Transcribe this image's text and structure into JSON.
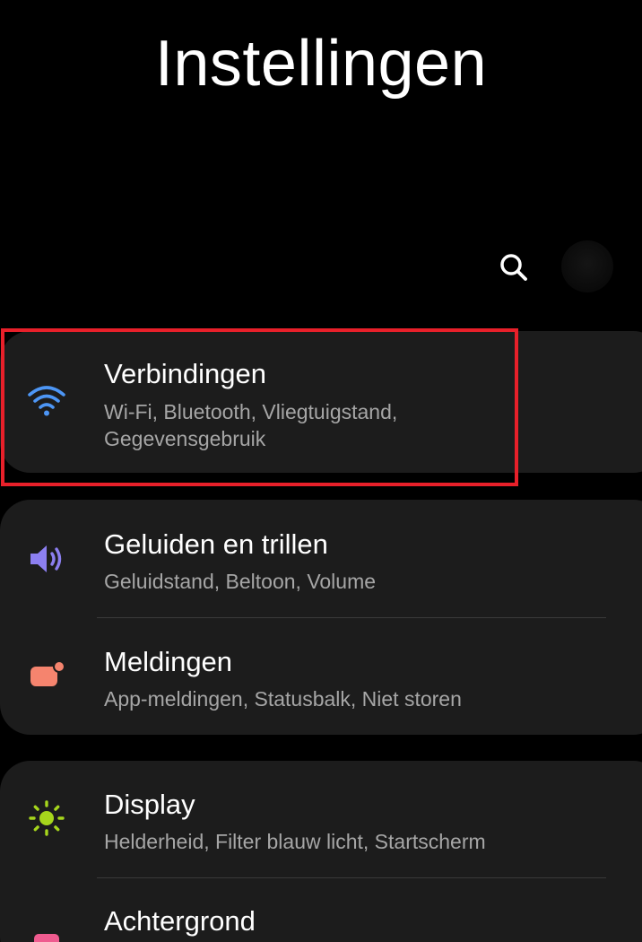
{
  "header": {
    "title": "Instellingen",
    "search_icon": "search-icon",
    "avatar_icon": "profile-avatar"
  },
  "groups": [
    {
      "items": [
        {
          "icon": "wifi-icon",
          "icon_color": "#4d96f5",
          "label": "Verbindingen",
          "subtitle": "Wi-Fi, Bluetooth, Vliegtuigstand, Gegevensgebruik",
          "highlighted": true
        }
      ]
    },
    {
      "items": [
        {
          "icon": "volume-icon",
          "icon_color": "#8c7ff0",
          "label": "Geluiden en trillen",
          "subtitle": "Geluidstand, Beltoon, Volume"
        },
        {
          "icon": "notification-icon",
          "icon_color": "#f5846e",
          "label": "Meldingen",
          "subtitle": "App-meldingen, Statusbalk, Niet storen"
        }
      ]
    },
    {
      "items": [
        {
          "icon": "brightness-icon",
          "icon_color": "#a6d61c",
          "label": "Display",
          "subtitle": "Helderheid, Filter blauw licht, Startscherm"
        },
        {
          "icon": "wallpaper-icon",
          "icon_color": "#ef5b8f",
          "label": "Achtergrond",
          "subtitle": ""
        }
      ]
    }
  ],
  "colors": {
    "background": "#000000",
    "card": "#1c1c1c",
    "highlight": "#e8202a",
    "subtitle": "#a6a6a6"
  }
}
